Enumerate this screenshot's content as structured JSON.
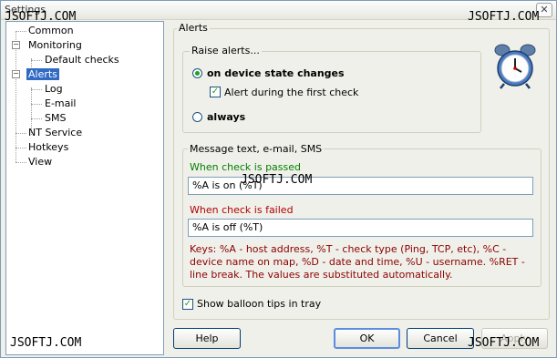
{
  "window": {
    "title": "Settings",
    "close_symbol": "✕"
  },
  "watermarks": [
    "JSOFTJ.COM",
    "JSOFTJ.COM",
    "JSOFTJ.COM",
    "JSOFTJ.COM",
    "JSOFTJ.COM"
  ],
  "tree": {
    "items": [
      {
        "label": "Common",
        "selected": false
      },
      {
        "label": "Monitoring",
        "selected": false,
        "expander": "−"
      },
      {
        "label": "Default checks",
        "selected": false
      },
      {
        "label": "Alerts",
        "selected": true,
        "expander": "−"
      },
      {
        "label": "Log",
        "selected": false
      },
      {
        "label": "E-mail",
        "selected": false
      },
      {
        "label": "SMS",
        "selected": false
      },
      {
        "label": "NT Service",
        "selected": false
      },
      {
        "label": "Hotkeys",
        "selected": false
      },
      {
        "label": "View",
        "selected": false
      }
    ]
  },
  "alerts": {
    "group_title": "Alerts",
    "raise": {
      "title": "Raise alerts...",
      "option_state_changes": "on device state changes",
      "first_check_label": "Alert during the first check",
      "first_check_checked": true,
      "option_always": "always",
      "selected": "state_changes"
    },
    "message": {
      "title": "Message text, e-mail, SMS",
      "passed_label": "When check is passed",
      "passed_value": "%A is on (%T)",
      "failed_label": "When check is failed",
      "failed_value": "%A is off (%T)",
      "keys_help": "Keys: %A - host address, %T - check type (Ping, TCP, etc), %C - device name on map, %D - date and time, %U - username. %RET - line break. The values are substituted automatically."
    },
    "balloon_label": "Show balloon tips in tray",
    "balloon_checked": true
  },
  "buttons": {
    "help": "Help",
    "ok": "OK",
    "cancel": "Cancel",
    "apply": "Apply"
  },
  "colors": {
    "passed_label": "#008000",
    "failed_label": "#b00000",
    "selection": "#316ac5"
  },
  "icons": {
    "alarm": "alarm-clock-icon",
    "check": "✓"
  }
}
